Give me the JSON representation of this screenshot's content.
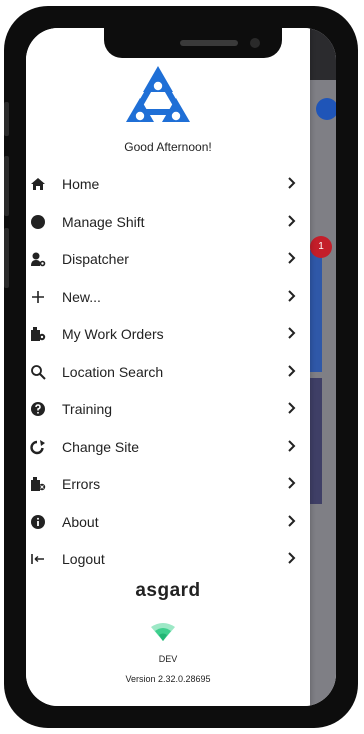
{
  "greeting": "Good Afternoon!",
  "menu": [
    {
      "label": "Home",
      "icon": "home-icon"
    },
    {
      "label": "Manage Shift",
      "icon": "clock-icon"
    },
    {
      "label": "Dispatcher",
      "icon": "dispatcher-icon"
    },
    {
      "label": "New...",
      "icon": "plus-icon"
    },
    {
      "label": "My Work Orders",
      "icon": "work-orders-icon"
    },
    {
      "label": "Location Search",
      "icon": "search-icon"
    },
    {
      "label": "Training",
      "icon": "help-icon"
    },
    {
      "label": "Change Site",
      "icon": "change-site-icon"
    },
    {
      "label": "Errors",
      "icon": "errors-icon"
    },
    {
      "label": "About",
      "icon": "info-icon"
    },
    {
      "label": "Logout",
      "icon": "logout-icon"
    }
  ],
  "brand": "asgard",
  "environment": "DEV",
  "version": "Version 2.32.0.28695",
  "background_badge": "1",
  "colors": {
    "logo_blue": "#1f6fd6",
    "wifi_green": "#3ecf8e",
    "badge_red": "#c41e2a"
  }
}
